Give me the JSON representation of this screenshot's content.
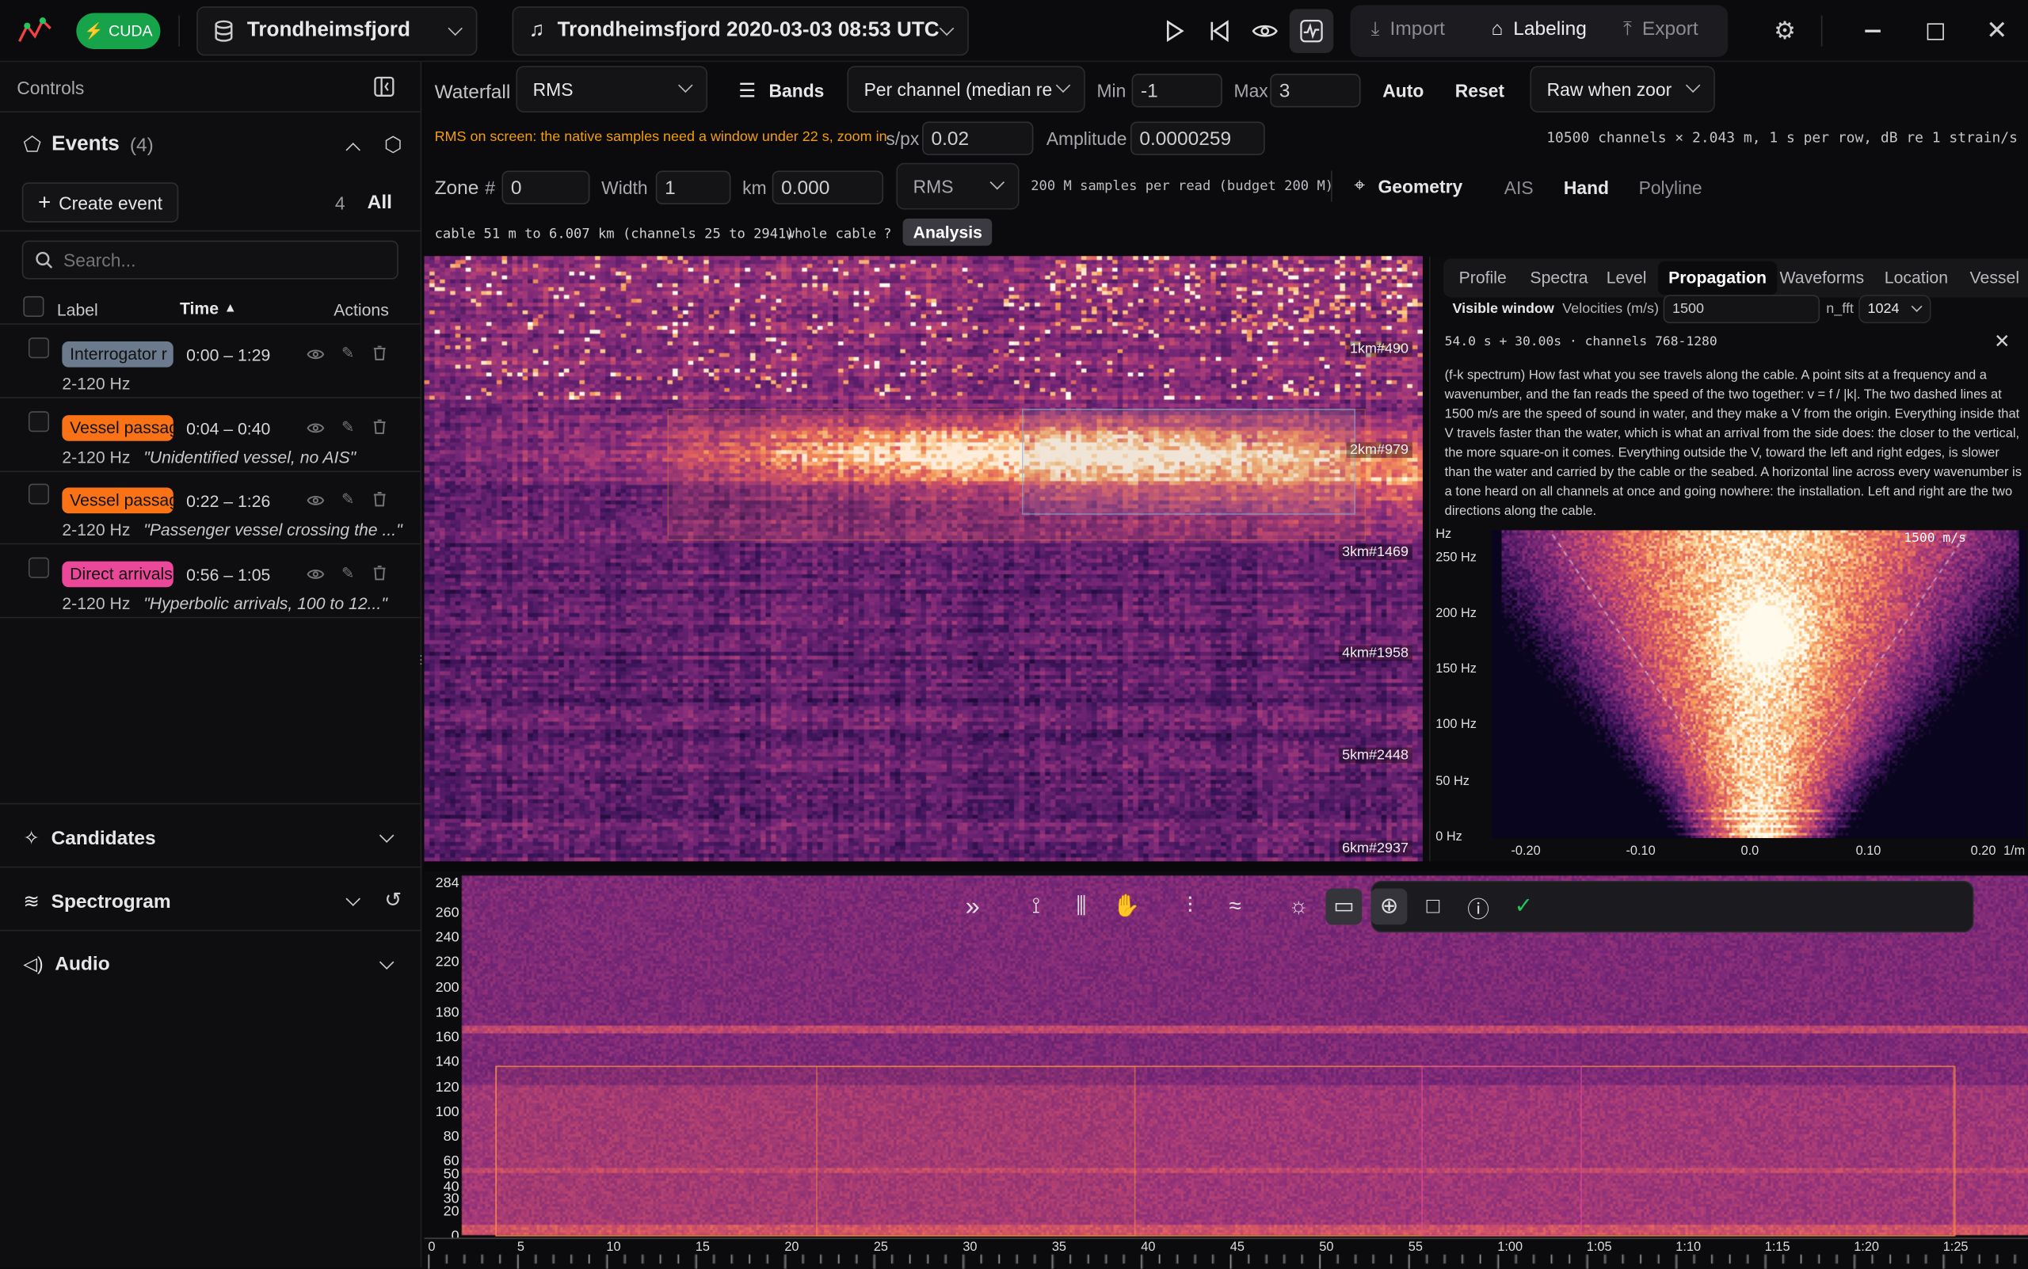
{
  "titlebar": {
    "gpu_badge": "CUDA",
    "dataset": "Trondheimsfjord",
    "recording": "Trondheimsfjord 2020-03-03 08:53 UTC",
    "import_label": "Import",
    "labeling_label": "Labeling",
    "export_label": "Export"
  },
  "sidebar": {
    "controls_title": "Controls",
    "events_title": "Events",
    "events_count": "(4)",
    "create_event": "Create event",
    "filter_count": "4",
    "filter_all": "All",
    "search_placeholder": "Search...",
    "col_label": "Label",
    "col_time": "Time",
    "col_actions": "Actions",
    "events": [
      {
        "label": "Interrogator r",
        "time": "0:00 – 1:29",
        "band": "2-120 Hz",
        "note": "",
        "color": "#6b7a8c"
      },
      {
        "label": "Vessel passag",
        "time": "0:04 – 0:40",
        "band": "2-120 Hz",
        "note": "\"Unidentified vessel, no AIS\"",
        "color": "#f97316"
      },
      {
        "label": "Vessel passag",
        "time": "0:22 – 1:26",
        "band": "2-120 Hz",
        "note": "\"Passenger vessel crossing the ...\"",
        "color": "#f97316"
      },
      {
        "label": "Direct arrivals",
        "time": "0:56 – 1:05",
        "band": "2-120 Hz",
        "note": "\"Hyperbolic arrivals, 100 to 12...\"",
        "color": "#ec4899"
      }
    ],
    "candidates": "Candidates",
    "spectrogram": "Spectrogram",
    "audio": "Audio"
  },
  "toolbar": {
    "waterfall_label": "Waterfall",
    "waterfall_mode": "RMS",
    "bands_label": "Bands",
    "norm_mode": "Per channel (median re",
    "min_label": "Min",
    "min_value": "-1",
    "max_label": "Max",
    "max_value": "3",
    "auto": "Auto",
    "reset": "Reset",
    "raw_mode": "Raw when zoor",
    "warning": "RMS on screen: the native samples need a window under 22 s, zoom in",
    "spx_label": "s/px",
    "spx_value": "0.02",
    "amp_label": "Amplitude",
    "amp_value": "0.0000259",
    "channels_info": "10500 channels × 2.043 m, 1 s per row, dB re 1 strain/s",
    "zone_label": "Zone",
    "zone_hash": "#",
    "zone_value": "0",
    "width_label": "Width",
    "width_value": "1",
    "km_label": "km",
    "km_value": "0.000",
    "zone_mode": "RMS",
    "samples_info": "200 M samples per read (budget 200 M)",
    "geometry": "Geometry",
    "ais": "AIS",
    "hand": "Hand",
    "polyline": "Polyline",
    "cable_info": "cable 51 m to 6.007 km (channels 25 to 2941)",
    "whole_cable": "whole cable",
    "help_q": "?",
    "analysis": "Analysis"
  },
  "waterfall": {
    "markers": [
      "1km#490",
      "2km#979",
      "3km#1469",
      "4km#1958",
      "5km#2448",
      "6km#2937"
    ]
  },
  "analysis": {
    "tabs": [
      "Profile",
      "Spectra",
      "Level",
      "Propagation",
      "Waveforms",
      "Location",
      "Vessel"
    ],
    "active_tab": "Propagation",
    "visible_window": "Visible window",
    "velocities_label": "Velocities (m/s)",
    "velocities_value": "1500",
    "nfft_label": "n_fft",
    "nfft_value": "1024",
    "window_info": "54.0 s + 30.00s · channels 768-1280",
    "description": "(f-k spectrum) How fast what you see travels along the cable. A point sits at a frequency and a wavenumber, and the fan reads the speed of the two together: v = f / |k|. The two dashed lines at 1500 m/s are the speed of sound in water, and they make a V from the origin. Everything inside that V travels faster than the water, which is what an arrival from the side does: the closer to the vertical, the more square-on it comes. Everything outside the V, toward the left and right edges, is slower than the water and carried by the cable or the seabed. A horizontal line across every wavenumber is a tone heard on all channels at once and going nowhere: the installation. Left and right are the two directions along the cable.",
    "fk_y_unit": "Hz",
    "fk_y_ticks": [
      "250 Hz",
      "200 Hz",
      "150 Hz",
      "100 Hz",
      "50 Hz",
      "0 Hz"
    ],
    "fk_x_ticks": [
      "-0.20",
      "-0.10",
      "0.0",
      "0.10",
      "0.20"
    ],
    "fk_x_unit": "1/m",
    "fk_line_label": "1500 m/s"
  },
  "spectrogram": {
    "y_ticks": [
      "284",
      "260",
      "240",
      "220",
      "200",
      "180",
      "160",
      "140",
      "120",
      "100",
      "80",
      "60",
      "50",
      "40",
      "30",
      "20",
      "0"
    ],
    "x_ticks": [
      "0",
      "5",
      "10",
      "15",
      "20",
      "25",
      "30",
      "35",
      "40",
      "45",
      "50",
      "55",
      "1:00",
      "1:05",
      "1:10",
      "1:15",
      "1:20",
      "1:25"
    ]
  },
  "icons": {
    "app": "waveform-logo-icon",
    "database": "database-icon",
    "music": "music-note-icon"
  }
}
